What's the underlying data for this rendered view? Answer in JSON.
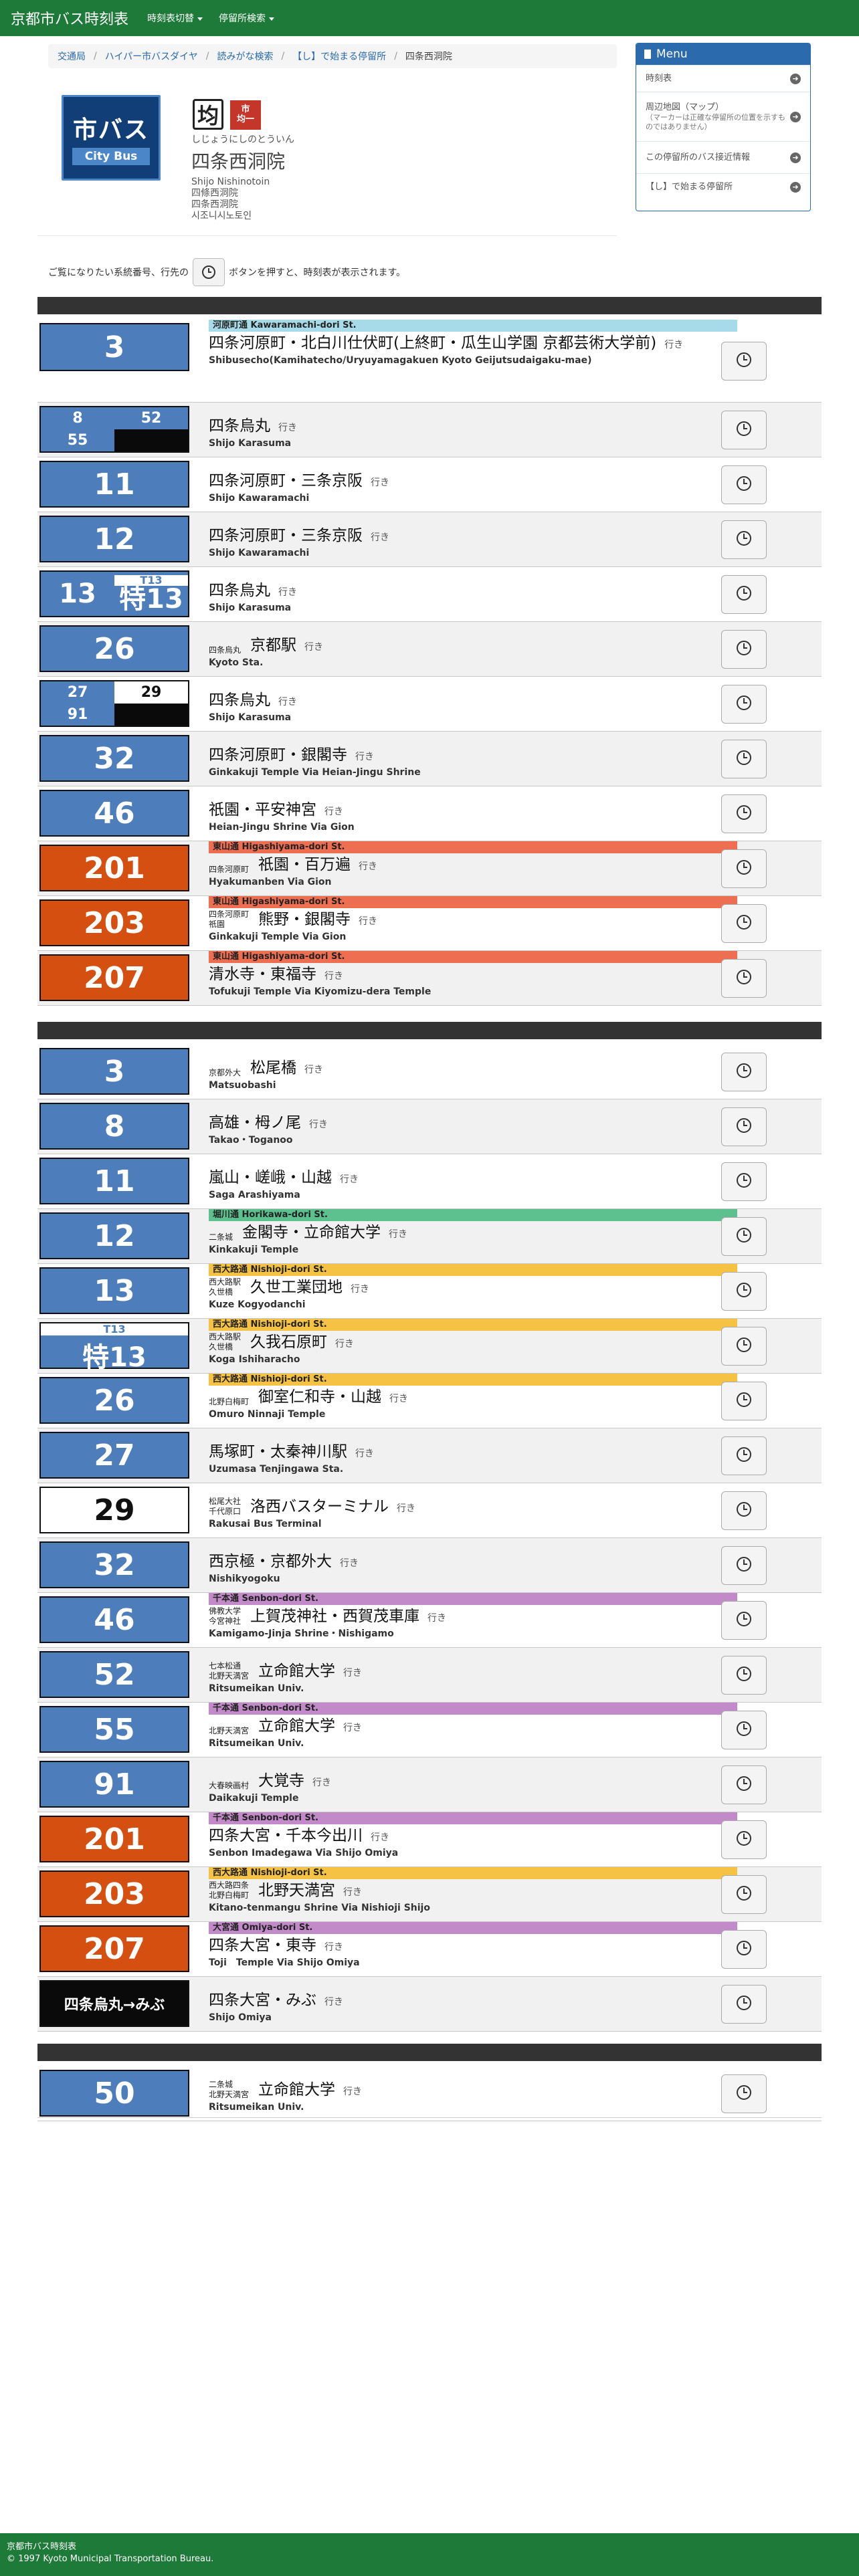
{
  "nav": {
    "brand": "京都市バス時刻表",
    "menu1": "時刻表切替",
    "menu2": "停留所検索"
  },
  "breadcrumb": [
    "交通局",
    "ハイパー市バスダイヤ",
    "読みがな検索",
    "【し】で始まる停留所",
    "四条西洞院"
  ],
  "header": {
    "logo_jp": "市バス",
    "logo_en": "City Bus",
    "kanji_badge": "均",
    "bus_badge": "市\n均一",
    "kana": "しじょうにしのとういん",
    "name": "四条西洞院",
    "alt_names": [
      "Shijo Nishinotoin",
      "四條西洞院",
      "四条西洞院",
      "시조니시노토인"
    ]
  },
  "instruction": {
    "before": "ご覧になりたい系統番号、行先の",
    "after": "ボタンを押すと、時刻表が表示されます。"
  },
  "menu": {
    "title": "Menu",
    "items": [
      {
        "label": "時刻表",
        "note": ""
      },
      {
        "label": "周辺地図（マップ）",
        "note": "（マーカーは正確な停留所の位置を示すものではありません）"
      },
      {
        "label": "この停留所のバス接近情報",
        "note": ""
      },
      {
        "label": "【し】で始まる停留所",
        "note": ""
      }
    ]
  },
  "iki": "行き",
  "sections": [
    {
      "rows": [
        {
          "route": {
            "kind": "single",
            "color": "blue",
            "num": "3"
          },
          "strip": {
            "color": "lb",
            "text": "河原町通 Kawaramachi-dori St."
          },
          "via": "",
          "dest": "四条河原町・北白川仕伏町(上終町・瓜生山学園 京都芸術大学前)",
          "roman": "Shibusecho(Kamihatecho/Uryuyamagakuen Kyoto Geijutsudaigaku-mae)",
          "shade": false
        },
        {
          "route": {
            "kind": "grid",
            "cells": [
              {
                "t": "8"
              },
              {
                "t": "52"
              },
              {
                "t": "55"
              },
              {
                "t": "",
                "c": "blk"
              }
            ]
          },
          "strip": null,
          "via": "",
          "dest": "四条烏丸",
          "roman": "Shijo Karasuma",
          "shade": true
        },
        {
          "route": {
            "kind": "single",
            "color": "blue",
            "num": "11"
          },
          "strip": null,
          "via": "",
          "dest": "四条河原町・三条京阪",
          "roman": "Shijo Kawaramachi",
          "shade": false
        },
        {
          "route": {
            "kind": "single",
            "color": "blue",
            "num": "12"
          },
          "strip": null,
          "via": "",
          "dest": "四条河原町・三条京阪",
          "roman": "Shijo Kawaramachi",
          "shade": true
        },
        {
          "route": {
            "kind": "split",
            "main": "13",
            "sub": "T13",
            "sub_big": "特13"
          },
          "strip": null,
          "via": "",
          "dest": "四条烏丸",
          "roman": "Shijo Karasuma",
          "shade": false
        },
        {
          "route": {
            "kind": "single",
            "color": "blue",
            "num": "26"
          },
          "strip": null,
          "via": "四条烏丸",
          "dest": "京都駅",
          "roman": "Kyoto Sta.",
          "shade": true
        },
        {
          "route": {
            "kind": "grid",
            "cells": [
              {
                "t": "27"
              },
              {
                "t": "29",
                "c": "wht"
              },
              {
                "t": "91"
              },
              {
                "t": "",
                "c": "blk"
              }
            ]
          },
          "strip": null,
          "via": "",
          "dest": "四条烏丸",
          "roman": "Shijo Karasuma",
          "shade": false
        },
        {
          "route": {
            "kind": "single",
            "color": "blue",
            "num": "32"
          },
          "strip": null,
          "via": "",
          "dest": "四条河原町・銀閣寺",
          "roman": "Ginkakuji Temple Via Heian-Jingu Shrine",
          "shade": true
        },
        {
          "route": {
            "kind": "single",
            "color": "blue",
            "num": "46"
          },
          "strip": null,
          "via": "",
          "dest": "祇園・平安神宮",
          "roman": "Heian-Jingu Shrine Via Gion",
          "shade": false
        },
        {
          "route": {
            "kind": "single",
            "color": "orange",
            "num": "201"
          },
          "strip": {
            "color": "sal",
            "text": "東山通 Higashiyama-dori St."
          },
          "via": "四条河原町",
          "dest": "祇園・百万遍",
          "roman": "Hyakumanben Via Gion",
          "shade": true
        },
        {
          "route": {
            "kind": "single",
            "color": "orange",
            "num": "203"
          },
          "strip": {
            "color": "sal",
            "text": "東山通 Higashiyama-dori St."
          },
          "via": "四条河原町\n祇園",
          "dest": "熊野・銀閣寺",
          "roman": "Ginkakuji Temple Via Gion",
          "shade": false
        },
        {
          "route": {
            "kind": "single",
            "color": "orange",
            "num": "207"
          },
          "strip": {
            "color": "sal",
            "text": "東山通 Higashiyama-dori St."
          },
          "via": "",
          "dest": "清水寺・東福寺",
          "roman": "Tofukuji Temple Via Kiyomizu-dera Temple",
          "shade": true
        }
      ]
    },
    {
      "rows": [
        {
          "route": {
            "kind": "single",
            "color": "blue",
            "num": "3"
          },
          "strip": null,
          "via": "京都外大",
          "dest": "松尾橋",
          "roman": "Matsuobashi",
          "shade": false
        },
        {
          "route": {
            "kind": "single",
            "color": "blue",
            "num": "8"
          },
          "strip": null,
          "via": "",
          "dest": "高雄・栂ノ尾",
          "roman": "Takao・Toganoo",
          "shade": true
        },
        {
          "route": {
            "kind": "single",
            "color": "blue",
            "num": "11"
          },
          "strip": null,
          "via": "",
          "dest": "嵐山・嵯峨・山越",
          "roman": "Saga Arashiyama",
          "shade": false
        },
        {
          "route": {
            "kind": "single",
            "color": "blue",
            "num": "12"
          },
          "strip": {
            "color": "grn",
            "text": "堀川通 Horikawa-dori St."
          },
          "via": "二条城",
          "dest": "金閣寺・立命館大学",
          "roman": "Kinkakuji Temple",
          "shade": true
        },
        {
          "route": {
            "kind": "single",
            "color": "blue",
            "num": "13"
          },
          "strip": {
            "color": "yel",
            "text": "西大路通 Nishioji-dori St."
          },
          "via": "西大路駅\n久世橋",
          "dest": "久世工業団地",
          "roman": "Kuze Kogyodanchi",
          "shade": false
        },
        {
          "route": {
            "kind": "tok",
            "sub": "T13",
            "main": "特13"
          },
          "strip": {
            "color": "yel",
            "text": "西大路通 Nishioji-dori St."
          },
          "via": "西大路駅\n久世橋",
          "dest": "久我石原町",
          "roman": "Koga Ishiharacho",
          "shade": true
        },
        {
          "route": {
            "kind": "single",
            "color": "blue",
            "num": "26"
          },
          "strip": {
            "color": "yel",
            "text": "西大路通 Nishioji-dori St."
          },
          "via": "北野白梅町",
          "dest": "御室仁和寺・山越",
          "roman": "Omuro Ninnaji Temple",
          "shade": false
        },
        {
          "route": {
            "kind": "single",
            "color": "blue",
            "num": "27"
          },
          "strip": null,
          "via": "",
          "dest": "馬塚町・太秦神川駅",
          "roman": "Uzumasa Tenjingawa Sta.",
          "shade": true
        },
        {
          "route": {
            "kind": "single",
            "color": "white",
            "num": "29"
          },
          "strip": null,
          "via": "松尾大社\n千代原口",
          "dest": "洛西バスターミナル",
          "roman": "Rakusai Bus Terminal",
          "shade": false
        },
        {
          "route": {
            "kind": "single",
            "color": "blue",
            "num": "32"
          },
          "strip": null,
          "via": "",
          "dest": "西京極・京都外大",
          "roman": "Nishikyogoku",
          "shade": true
        },
        {
          "route": {
            "kind": "single",
            "color": "blue",
            "num": "46"
          },
          "strip": {
            "color": "pur",
            "text": "千本通 Senbon-dori St."
          },
          "via": "佛教大学\n今宮神社",
          "dest": "上賀茂神社・西賀茂車庫",
          "roman": "Kamigamo-Jinja Shrine・Nishigamo",
          "shade": false
        },
        {
          "route": {
            "kind": "single",
            "color": "blue",
            "num": "52"
          },
          "strip": null,
          "via": "七本松通\n北野天満宮",
          "dest": "立命館大学",
          "roman": "Ritsumeikan Univ.",
          "shade": true
        },
        {
          "route": {
            "kind": "single",
            "color": "blue",
            "num": "55"
          },
          "strip": {
            "color": "pur",
            "text": "千本通 Senbon-dori St."
          },
          "via": "北野天満宮",
          "dest": "立命館大学",
          "roman": "Ritsumeikan Univ.",
          "shade": false
        },
        {
          "route": {
            "kind": "single",
            "color": "blue",
            "num": "91"
          },
          "strip": null,
          "via": "大春映画村",
          "dest": "大覚寺",
          "roman": "Daikakuji Temple",
          "shade": true
        },
        {
          "route": {
            "kind": "single",
            "color": "orange",
            "num": "201"
          },
          "strip": {
            "color": "pur",
            "text": "千本通 Senbon-dori St."
          },
          "via": "",
          "dest": "四条大宮・千本今出川",
          "roman": "Senbon Imadegawa Via Shijo Omiya",
          "shade": false
        },
        {
          "route": {
            "kind": "single",
            "color": "orange",
            "num": "203"
          },
          "strip": {
            "color": "yel",
            "text": "西大路通 Nishioji-dori St."
          },
          "via": "西大路四条\n北野白梅町",
          "dest": "北野天満宮",
          "roman": "Kitano-tenmangu Shrine Via Nishioji Shijo",
          "shade": true
        },
        {
          "route": {
            "kind": "single",
            "color": "orange",
            "num": "207"
          },
          "strip": {
            "color": "pur",
            "text": "大宮通 Omiya-dori St."
          },
          "via": "",
          "dest": "四条大宮・東寺",
          "roman": "Toji　Temple Via Shijo Omiya",
          "shade": false
        },
        {
          "route": {
            "kind": "single",
            "color": "black",
            "num": "四条烏丸→みぶ",
            "small": true
          },
          "strip": null,
          "via": "",
          "dest": "四条大宮・みぶ",
          "roman": "Shijo Omiya",
          "shade": true
        }
      ]
    },
    {
      "rows": [
        {
          "route": {
            "kind": "single",
            "color": "blue",
            "num": "50"
          },
          "strip": null,
          "via": "二条城\n北野天満宮",
          "dest": "立命館大学",
          "roman": "Ritsumeikan Univ.",
          "shade": false
        }
      ]
    }
  ],
  "footer": {
    "line1": "京都市バス時刻表",
    "line2": "© 1997 Kyoto Municipal Transportation Bureau."
  }
}
